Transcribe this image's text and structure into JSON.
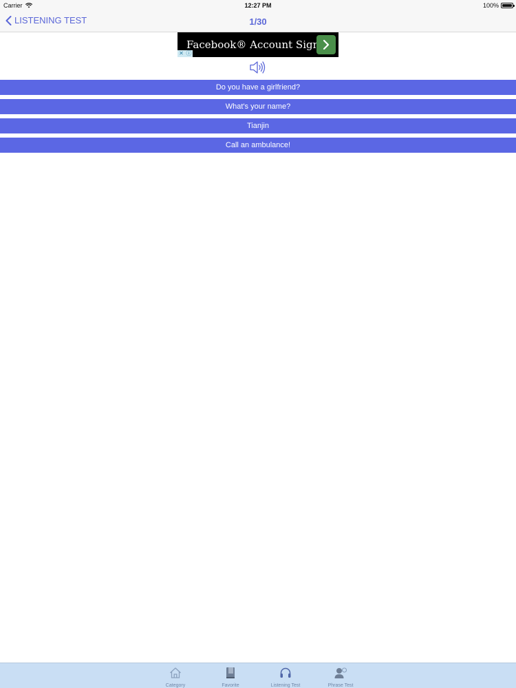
{
  "status": {
    "carrier": "Carrier",
    "time": "12:27 PM",
    "battery_text": "100%",
    "battery_level": 1.0
  },
  "nav": {
    "back_label": "LISTENING TEST",
    "title": "1/30"
  },
  "ad": {
    "text": "Facebook® Account Sign Up"
  },
  "answers": [
    {
      "label": "Do you have a girlfriend?"
    },
    {
      "label": "What's your name?"
    },
    {
      "label": "Tianjin"
    },
    {
      "label": "Call an ambulance!"
    }
  ],
  "tabs": [
    {
      "label": "Category",
      "icon": "home-icon"
    },
    {
      "label": "Favorite",
      "icon": "book-icon"
    },
    {
      "label": "Listening Test",
      "icon": "headphones-icon"
    },
    {
      "label": "Phrase Test",
      "icon": "speaking-person-icon"
    }
  ],
  "colors": {
    "accent": "#5b67d8",
    "answer_bg": "#5b67e4",
    "tab_bar_bg": "#c9def4",
    "ad_arrow": "#4a8f4a"
  }
}
